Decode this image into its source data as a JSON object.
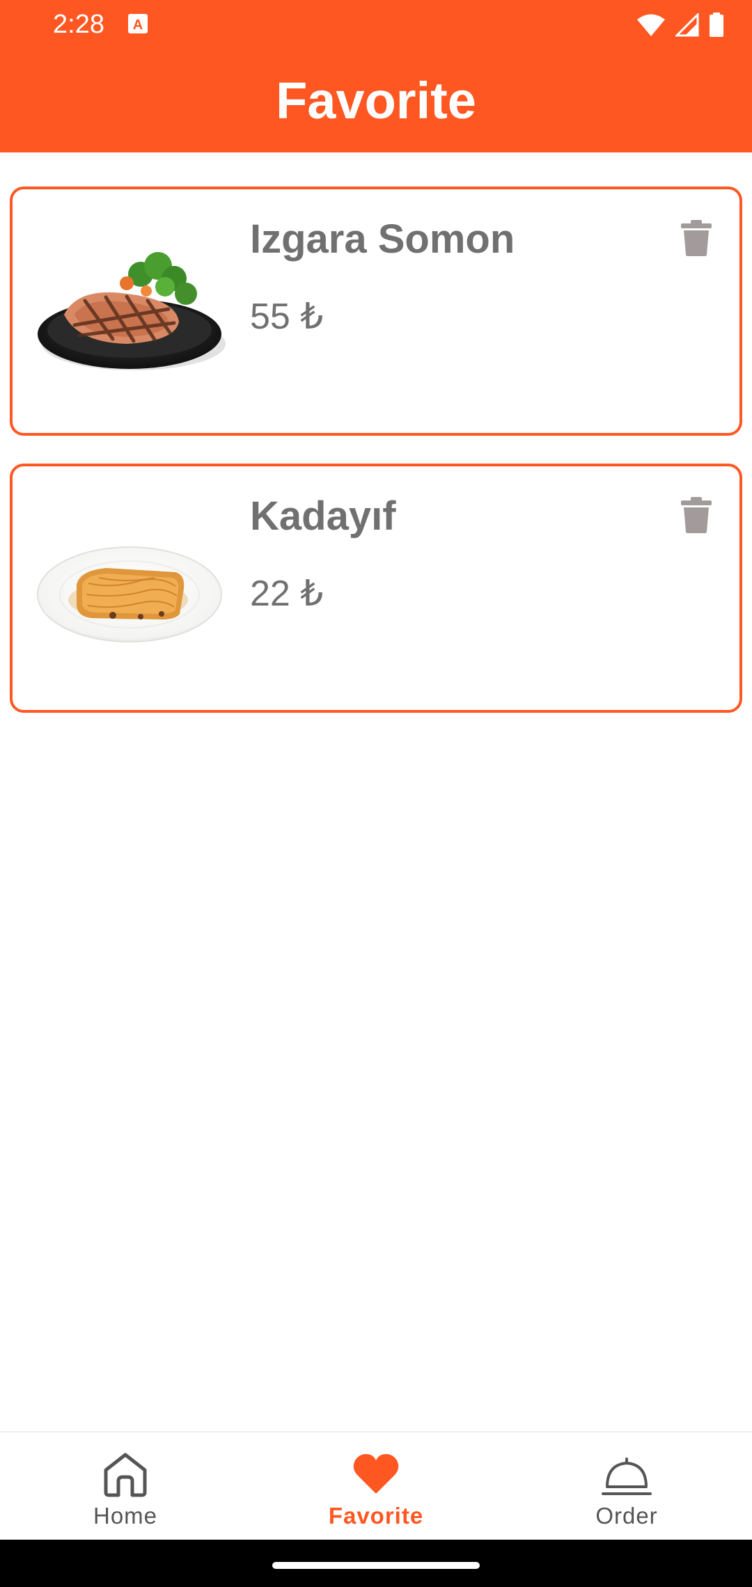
{
  "status_bar": {
    "time": "2:28",
    "icons": [
      "app-notification-icon",
      "wifi-icon",
      "cell-signal-icon",
      "battery-icon"
    ]
  },
  "header": {
    "title": "Favorite"
  },
  "favorites": [
    {
      "name": "Izgara Somon",
      "price": "55 ₺",
      "image": "grilled-salmon-image",
      "action_icon": "trash-icon"
    },
    {
      "name": "Kadayıf",
      "price": "22 ₺",
      "image": "kadayif-dessert-image",
      "action_icon": "trash-icon"
    }
  ],
  "bottom_nav": {
    "items": [
      {
        "label": "Home",
        "icon": "home-icon",
        "active": false
      },
      {
        "label": "Favorite",
        "icon": "heart-icon",
        "active": true
      },
      {
        "label": "Order",
        "icon": "cloche-icon",
        "active": false
      }
    ]
  },
  "colors": {
    "primary": "#FF5722",
    "text_gray": "#707070",
    "icon_gray": "#A39B9B",
    "nav_inactive": "#555555"
  }
}
